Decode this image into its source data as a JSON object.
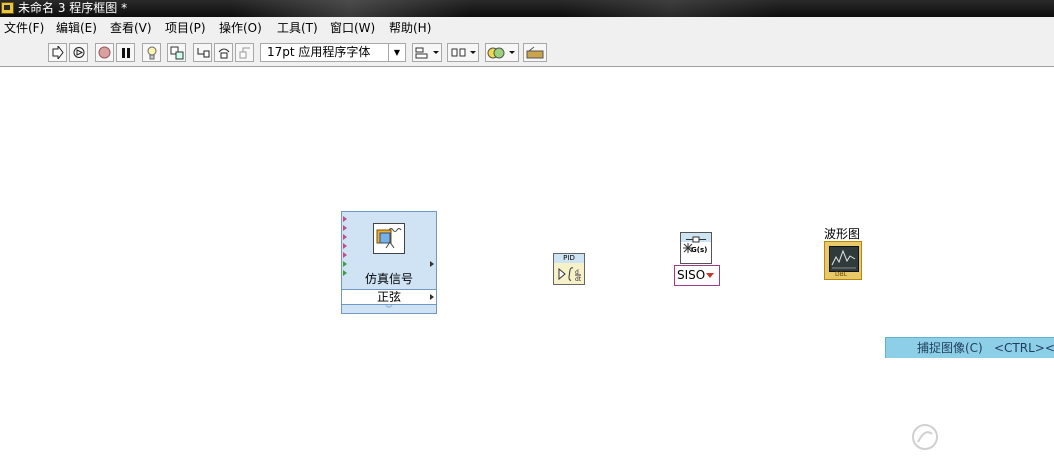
{
  "window": {
    "title": "未命名 3 程序框图 *"
  },
  "menu": [
    "文件(F)",
    "编辑(E)",
    "查看(V)",
    "项目(P)",
    "操作(O)",
    "工具(T)",
    "窗口(W)",
    "帮助(H)"
  ],
  "toolbar": {
    "font_select": "17pt 应用程序字体"
  },
  "nodes": {
    "simulate_signal": {
      "label": "仿真信号",
      "ring_value": "正弦"
    },
    "pid": {
      "header": "PID"
    },
    "siso_selector": {
      "value": "SISO"
    },
    "waveform_chart": {
      "label": "波形图",
      "type_badge": "DBL"
    }
  },
  "shortcut_bar": {
    "label": "捕捉图像(C)",
    "key": "<CTRL><S"
  },
  "colors": {
    "node_bg": "#cfe3f5",
    "shortcut_bg": "#8ecfe8",
    "waveform_bg": "#e7c96a"
  }
}
